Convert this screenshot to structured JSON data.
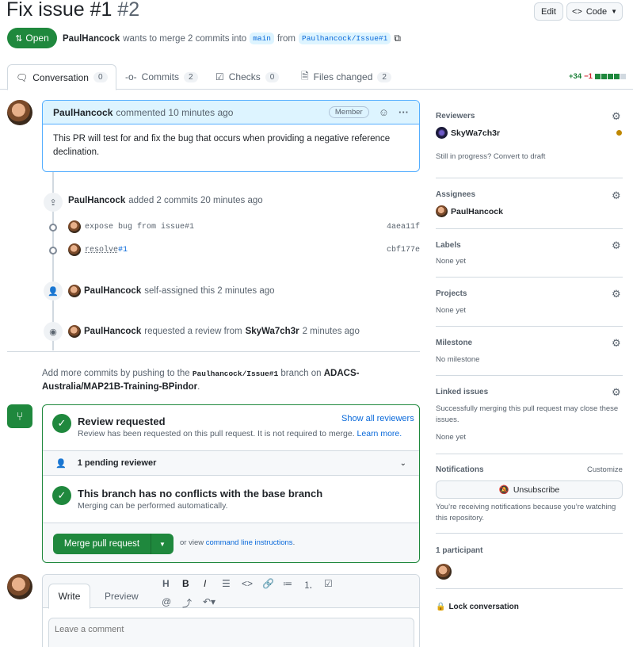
{
  "pr": {
    "title": "Fix issue #1",
    "number": "#2",
    "state": "Open",
    "author": "PaulHancock",
    "meta_text": "wants to merge 2 commits into",
    "base_branch": "main",
    "from_text": "from",
    "head_branch": "Paulhancock/Issue#1"
  },
  "header_buttons": {
    "edit": "Edit",
    "code": "Code"
  },
  "tabs": [
    {
      "label": "Conversation",
      "count": "0"
    },
    {
      "label": "Commits",
      "count": "2"
    },
    {
      "label": "Checks",
      "count": "0"
    },
    {
      "label": "Files changed",
      "count": "2"
    }
  ],
  "diffstat": {
    "additions": "+34",
    "deletions": "−1"
  },
  "first_comment": {
    "author": "PaulHancock",
    "action": "commented 10 minutes ago",
    "badge": "Member",
    "body": "This PR will test for and fix the bug that occurs when providing a negative reference declination."
  },
  "commits_event": {
    "author": "PaulHancock",
    "text": "added 2 commits 20 minutes ago"
  },
  "commits": [
    {
      "message": "expose bug from issue#1",
      "sha": "4aea11f"
    },
    {
      "message_prefix": "resolve ",
      "message_link": "#1",
      "sha": "cbf177e"
    }
  ],
  "assign_event": {
    "author": "PaulHancock",
    "text": "self-assigned this 2 minutes ago"
  },
  "review_event": {
    "author": "PaulHancock",
    "text": "requested a review from",
    "reviewer": "SkyWa7ch3r",
    "time": "2 minutes ago"
  },
  "push_hint": {
    "prefix": "Add more commits by pushing to the",
    "branch": "Paulhancock/Issue#1",
    "mid": "branch on",
    "repo": "ADACS-Australia/MAP21B-Training-BPindor",
    "suffix": "."
  },
  "merge": {
    "review_title": "Review requested",
    "review_desc": "Review has been requested on this pull request. It is not required to merge.",
    "learn_more": "Learn more.",
    "show_all": "Show all reviewers",
    "pending": "1 pending reviewer",
    "conflict_title": "This branch has no conflicts with the base branch",
    "conflict_desc": "Merging can be performed automatically.",
    "merge_button": "Merge pull request",
    "or_view": "or view",
    "cli_link": "command line instructions",
    "cli_suffix": "."
  },
  "editor": {
    "write_tab": "Write",
    "preview_tab": "Preview",
    "placeholder": "Leave a comment"
  },
  "sidebar": {
    "reviewers_label": "Reviewers",
    "reviewer_name": "SkyWa7ch3r",
    "draft_hint": "Still in progress? Convert to draft",
    "assignees_label": "Assignees",
    "assignee_name": "PaulHancock",
    "labels_label": "Labels",
    "labels_value": "None yet",
    "projects_label": "Projects",
    "projects_value": "None yet",
    "milestone_label": "Milestone",
    "milestone_value": "No milestone",
    "linked_label": "Linked issues",
    "linked_desc": "Successfully merging this pull request may close these issues.",
    "linked_value": "None yet",
    "notifications_label": "Notifications",
    "customize": "Customize",
    "unsubscribe": "Unsubscribe",
    "notif_desc": "You’re receiving notifications because you’re watching this repository.",
    "participants_label": "1 participant",
    "lock": "Lock conversation"
  },
  "colors": {
    "success": "#1f883d",
    "accent": "#0969da",
    "muted": "#59636e",
    "border": "#d1d9e0",
    "comment_header": "#ddf4ff",
    "pending_dot": "#bf8700"
  }
}
